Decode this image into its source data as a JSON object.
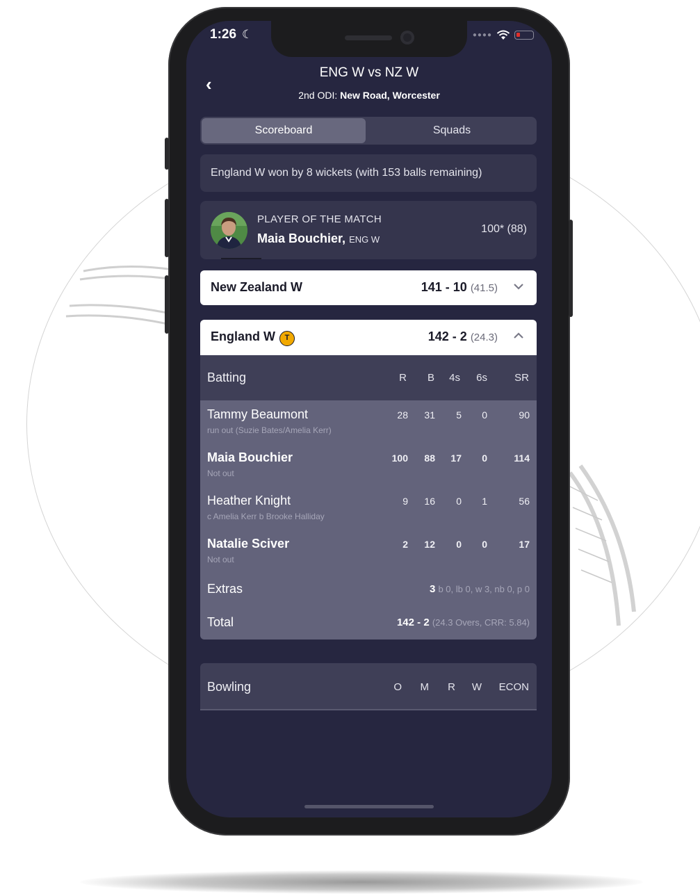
{
  "status_bar": {
    "time": "1:26",
    "moon_icon": "moon-icon",
    "wifi_icon": "wifi-icon",
    "battery_icon": "battery-icon"
  },
  "header": {
    "back_icon": "chevron-left-icon",
    "title": "ENG W vs NZ W",
    "subtitle_prefix": "2nd ODI: ",
    "subtitle_venue": "New Road, Worcester"
  },
  "tabs": [
    {
      "label": "Scoreboard",
      "active": true
    },
    {
      "label": "Squads",
      "active": false
    }
  ],
  "result": "England W won by 8 wickets (with 153 balls remaining)",
  "player_of_match": {
    "label": "PLAYER OF THE MATCH",
    "name": "Maia Bouchier,",
    "team": "ENG W",
    "score": "100* (88)"
  },
  "innings": [
    {
      "team": "New Zealand W",
      "score": "141 - 10",
      "overs": "(41.5)",
      "expanded": false,
      "toss": false
    },
    {
      "team": "England W",
      "score": "142 - 2",
      "overs": "(24.3)",
      "expanded": true,
      "toss": true,
      "toss_label": "T"
    }
  ],
  "batting": {
    "title": "Batting",
    "columns": [
      "R",
      "B",
      "4s",
      "6s",
      "SR"
    ],
    "rows": [
      {
        "name": "Tammy Beaumont",
        "dismissal": "run out (Suzie Bates/Amelia Kerr)",
        "r": "28",
        "b": "31",
        "fours": "5",
        "sixes": "0",
        "sr": "90",
        "not_out": false
      },
      {
        "name": "Maia Bouchier",
        "dismissal": "Not out",
        "r": "100",
        "b": "88",
        "fours": "17",
        "sixes": "0",
        "sr": "114",
        "not_out": true
      },
      {
        "name": "Heather Knight",
        "dismissal": "c Amelia Kerr b Brooke Halliday",
        "r": "9",
        "b": "16",
        "fours": "0",
        "sixes": "1",
        "sr": "56",
        "not_out": false
      },
      {
        "name": "Natalie Sciver",
        "dismissal": "Not out",
        "r": "2",
        "b": "12",
        "fours": "0",
        "sixes": "0",
        "sr": "17",
        "not_out": true
      }
    ],
    "extras_label": "Extras",
    "extras_value": "3",
    "extras_detail": "b 0, lb 0, w 3, nb 0, p 0",
    "total_label": "Total",
    "total_value": "142 - 2",
    "total_detail": "(24.3 Overs, CRR: 5.84)"
  },
  "bowling": {
    "title": "Bowling",
    "columns": [
      "O",
      "M",
      "R",
      "W",
      "ECON"
    ]
  },
  "colors": {
    "screen_bg": "#262640",
    "card_bg": "#35354d",
    "table_body": "#63637b",
    "toss_badge": "#f2a900"
  }
}
